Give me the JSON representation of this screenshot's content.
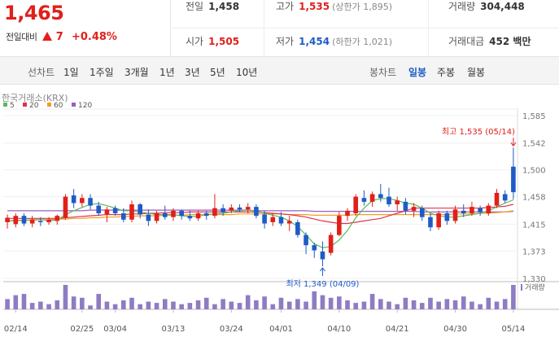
{
  "header": {
    "price": "1,465",
    "change_label": "전일대비",
    "change_value": "7",
    "change_pct": "+0.48%"
  },
  "info": {
    "prev_label": "전일",
    "prev_value": "1,458",
    "high_label": "고가",
    "high_value": "1,535",
    "high_sub": "(상한가 1,895)",
    "volume_label": "거래량",
    "volume_value": "304,448",
    "open_label": "시가",
    "open_value": "1,505",
    "low_label": "저가",
    "low_value": "1,454",
    "low_sub": "(하한가 1,021)",
    "amount_label": "거래대금",
    "amount_value": "452 백만"
  },
  "tabs": {
    "line_head": "선차트",
    "line": [
      "1일",
      "1주일",
      "3개월",
      "1년",
      "3년",
      "5년",
      "10년"
    ],
    "candle_head": "봉차트",
    "candle": [
      "일봉",
      "주봉",
      "월봉"
    ],
    "candle_active": 0
  },
  "colors": {
    "up": "#e0201b",
    "down": "#1e5bc6",
    "ma5": "#5cb85c",
    "ma20": "#e0334e",
    "ma60": "#f0a020",
    "ma120": "#9a5fbf",
    "volume": "#8e7cc3"
  },
  "chart_data": {
    "type": "candlestick",
    "source_label": "한국거래소(KRX)",
    "legend": [
      {
        "name": "5",
        "color": "#5cb85c"
      },
      {
        "name": "20",
        "color": "#e0334e"
      },
      {
        "name": "60",
        "color": "#f0a020"
      },
      {
        "name": "120",
        "color": "#9a5fbf"
      }
    ],
    "yticks": [
      "1,585",
      "1,542",
      "1,500",
      "1,458",
      "1,415",
      "1,373",
      "1,330"
    ],
    "ylim": [
      1330,
      1585
    ],
    "xticks": [
      {
        "label": "02/14",
        "i": 1
      },
      {
        "label": "02/25",
        "i": 9
      },
      {
        "label": "03/04",
        "i": 13
      },
      {
        "label": "03/13",
        "i": 20
      },
      {
        "label": "03/24",
        "i": 27
      },
      {
        "label": "04/01",
        "i": 33
      },
      {
        "label": "04/10",
        "i": 40
      },
      {
        "label": "04/21",
        "i": 47
      },
      {
        "label": "04/30",
        "i": 54
      },
      {
        "label": "05/14",
        "i": 61
      }
    ],
    "max_annotation": "최고 1,535 (05/14)",
    "min_annotation": "최저 1,349 (04/09)",
    "volume_label": "거래량",
    "candles": [
      {
        "o": 1418,
        "h": 1430,
        "l": 1408,
        "c": 1425
      },
      {
        "o": 1415,
        "h": 1432,
        "l": 1410,
        "c": 1428
      },
      {
        "o": 1428,
        "h": 1432,
        "l": 1412,
        "c": 1416
      },
      {
        "o": 1416,
        "h": 1428,
        "l": 1410,
        "c": 1422
      },
      {
        "o": 1420,
        "h": 1426,
        "l": 1412,
        "c": 1418
      },
      {
        "o": 1418,
        "h": 1426,
        "l": 1414,
        "c": 1422
      },
      {
        "o": 1420,
        "h": 1430,
        "l": 1414,
        "c": 1428
      },
      {
        "o": 1425,
        "h": 1462,
        "l": 1422,
        "c": 1458
      },
      {
        "o": 1460,
        "h": 1470,
        "l": 1440,
        "c": 1448
      },
      {
        "o": 1448,
        "h": 1462,
        "l": 1442,
        "c": 1456
      },
      {
        "o": 1456,
        "h": 1462,
        "l": 1438,
        "c": 1444
      },
      {
        "o": 1444,
        "h": 1450,
        "l": 1428,
        "c": 1432
      },
      {
        "o": 1430,
        "h": 1442,
        "l": 1418,
        "c": 1438
      },
      {
        "o": 1440,
        "h": 1444,
        "l": 1428,
        "c": 1432
      },
      {
        "o": 1432,
        "h": 1440,
        "l": 1418,
        "c": 1422
      },
      {
        "o": 1422,
        "h": 1452,
        "l": 1418,
        "c": 1446
      },
      {
        "o": 1446,
        "h": 1448,
        "l": 1424,
        "c": 1430
      },
      {
        "o": 1430,
        "h": 1438,
        "l": 1412,
        "c": 1420
      },
      {
        "o": 1420,
        "h": 1436,
        "l": 1416,
        "c": 1432
      },
      {
        "o": 1432,
        "h": 1444,
        "l": 1422,
        "c": 1426
      },
      {
        "o": 1426,
        "h": 1440,
        "l": 1420,
        "c": 1436
      },
      {
        "o": 1436,
        "h": 1438,
        "l": 1422,
        "c": 1428
      },
      {
        "o": 1428,
        "h": 1436,
        "l": 1420,
        "c": 1424
      },
      {
        "o": 1424,
        "h": 1436,
        "l": 1420,
        "c": 1432
      },
      {
        "o": 1432,
        "h": 1436,
        "l": 1422,
        "c": 1428
      },
      {
        "o": 1428,
        "h": 1462,
        "l": 1424,
        "c": 1440
      },
      {
        "o": 1440,
        "h": 1446,
        "l": 1428,
        "c": 1434
      },
      {
        "o": 1436,
        "h": 1446,
        "l": 1432,
        "c": 1441
      },
      {
        "o": 1441,
        "h": 1446,
        "l": 1434,
        "c": 1438
      },
      {
        "o": 1438,
        "h": 1448,
        "l": 1432,
        "c": 1442
      },
      {
        "o": 1442,
        "h": 1446,
        "l": 1424,
        "c": 1428
      },
      {
        "o": 1430,
        "h": 1436,
        "l": 1408,
        "c": 1416
      },
      {
        "o": 1418,
        "h": 1432,
        "l": 1412,
        "c": 1426
      },
      {
        "o": 1426,
        "h": 1434,
        "l": 1412,
        "c": 1416
      },
      {
        "o": 1416,
        "h": 1428,
        "l": 1404,
        "c": 1420
      },
      {
        "o": 1418,
        "h": 1422,
        "l": 1394,
        "c": 1398
      },
      {
        "o": 1398,
        "h": 1402,
        "l": 1368,
        "c": 1382
      },
      {
        "o": 1382,
        "h": 1386,
        "l": 1362,
        "c": 1374
      },
      {
        "o": 1372,
        "h": 1388,
        "l": 1349,
        "c": 1360
      },
      {
        "o": 1370,
        "h": 1402,
        "l": 1366,
        "c": 1398
      },
      {
        "o": 1398,
        "h": 1434,
        "l": 1396,
        "c": 1428
      },
      {
        "o": 1428,
        "h": 1440,
        "l": 1420,
        "c": 1436
      },
      {
        "o": 1432,
        "h": 1462,
        "l": 1428,
        "c": 1458
      },
      {
        "o": 1456,
        "h": 1468,
        "l": 1444,
        "c": 1450
      },
      {
        "o": 1450,
        "h": 1466,
        "l": 1442,
        "c": 1462
      },
      {
        "o": 1462,
        "h": 1478,
        "l": 1450,
        "c": 1456
      },
      {
        "o": 1458,
        "h": 1472,
        "l": 1442,
        "c": 1446
      },
      {
        "o": 1446,
        "h": 1458,
        "l": 1436,
        "c": 1452
      },
      {
        "o": 1450,
        "h": 1456,
        "l": 1430,
        "c": 1436
      },
      {
        "o": 1436,
        "h": 1448,
        "l": 1426,
        "c": 1442
      },
      {
        "o": 1440,
        "h": 1444,
        "l": 1420,
        "c": 1426
      },
      {
        "o": 1426,
        "h": 1432,
        "l": 1404,
        "c": 1410
      },
      {
        "o": 1410,
        "h": 1436,
        "l": 1406,
        "c": 1432
      },
      {
        "o": 1432,
        "h": 1436,
        "l": 1414,
        "c": 1420
      },
      {
        "o": 1420,
        "h": 1444,
        "l": 1416,
        "c": 1438
      },
      {
        "o": 1436,
        "h": 1446,
        "l": 1426,
        "c": 1432
      },
      {
        "o": 1432,
        "h": 1450,
        "l": 1428,
        "c": 1442
      },
      {
        "o": 1440,
        "h": 1444,
        "l": 1428,
        "c": 1434
      },
      {
        "o": 1432,
        "h": 1448,
        "l": 1428,
        "c": 1444
      },
      {
        "o": 1444,
        "h": 1470,
        "l": 1440,
        "c": 1464
      },
      {
        "o": 1462,
        "h": 1468,
        "l": 1448,
        "c": 1452
      },
      {
        "o": 1505,
        "h": 1535,
        "l": 1454,
        "c": 1465
      }
    ],
    "volumes": [
      40,
      55,
      60,
      25,
      30,
      20,
      35,
      95,
      50,
      45,
      15,
      60,
      30,
      20,
      35,
      45,
      20,
      30,
      25,
      40,
      30,
      20,
      25,
      35,
      45,
      20,
      40,
      30,
      25,
      55,
      35,
      50,
      20,
      45,
      30,
      40,
      30,
      70,
      55,
      45,
      50,
      35,
      25,
      30,
      60,
      40,
      30,
      20,
      45,
      35,
      25,
      45,
      30,
      40,
      35,
      50,
      30,
      20,
      45,
      30,
      40,
      95
    ],
    "ma5": [
      1420,
      1421,
      1421,
      1422,
      1422,
      1421,
      1421,
      1430,
      1436,
      1441,
      1446,
      1447,
      1444,
      1440,
      1436,
      1436,
      1434,
      1432,
      1430,
      1430,
      1430,
      1428,
      1427,
      1427,
      1430,
      1431,
      1432,
      1434,
      1436,
      1437,
      1436,
      1432,
      1429,
      1426,
      1420,
      1411,
      1398,
      1384,
      1378,
      1380,
      1390,
      1405,
      1425,
      1440,
      1452,
      1455,
      1455,
      1452,
      1448,
      1446,
      1440,
      1432,
      1428,
      1426,
      1426,
      1428,
      1430,
      1432,
      1436,
      1442,
      1448,
      1453
    ],
    "ma20": [
      1424,
      1424,
      1424,
      1424,
      1424,
      1424,
      1424,
      1425,
      1426,
      1427,
      1428,
      1429,
      1430,
      1430,
      1430,
      1431,
      1431,
      1432,
      1432,
      1433,
      1433,
      1433,
      1434,
      1434,
      1434,
      1434,
      1434,
      1434,
      1434,
      1434,
      1434,
      1433,
      1432,
      1431,
      1430,
      1428,
      1426,
      1423,
      1420,
      1418,
      1416,
      1416,
      1418,
      1420,
      1422,
      1424,
      1428,
      1432,
      1436,
      1440,
      1440,
      1440,
      1440,
      1440,
      1440,
      1440,
      1440,
      1440,
      1441,
      1442,
      1443,
      1446
    ],
    "ma60": [
      1420,
      1420,
      1421,
      1421,
      1422,
      1422,
      1423,
      1423,
      1424,
      1424,
      1425,
      1425,
      1426,
      1426,
      1427,
      1427,
      1428,
      1428,
      1428,
      1429,
      1429,
      1429,
      1430,
      1430,
      1430,
      1430,
      1430,
      1430,
      1431,
      1431,
      1431,
      1431,
      1431,
      1431,
      1430,
      1430,
      1430,
      1429,
      1429,
      1429,
      1429,
      1429,
      1430,
      1430,
      1430,
      1430,
      1430,
      1430,
      1430,
      1430,
      1430,
      1430,
      1430,
      1430,
      1431,
      1431,
      1431,
      1432,
      1432,
      1433,
      1434,
      1436
    ],
    "ma120": [
      1436,
      1436,
      1436,
      1436,
      1436,
      1436,
      1436,
      1436,
      1436,
      1436,
      1437,
      1437,
      1437,
      1437,
      1437,
      1437,
      1437,
      1437,
      1437,
      1437,
      1437,
      1437,
      1437,
      1437,
      1437,
      1437,
      1437,
      1437,
      1437,
      1437,
      1436,
      1436,
      1436,
      1436,
      1436,
      1436,
      1436,
      1435,
      1435,
      1435,
      1435,
      1435,
      1435,
      1435,
      1435,
      1435,
      1435,
      1435,
      1435,
      1435,
      1434,
      1434,
      1434,
      1434,
      1434,
      1434,
      1434,
      1434,
      1434,
      1434,
      1434,
      1435
    ]
  }
}
